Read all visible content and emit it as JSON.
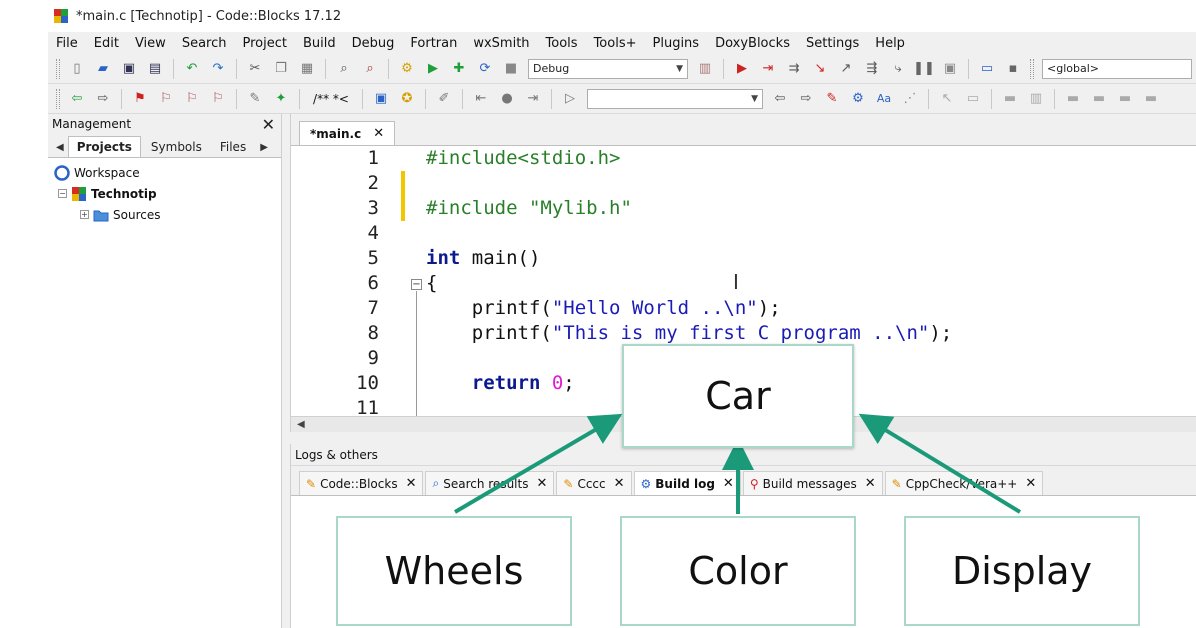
{
  "window": {
    "title": "*main.c [Technotip] - Code::Blocks 17.12"
  },
  "menu": [
    "File",
    "Edit",
    "View",
    "Search",
    "Project",
    "Build",
    "Debug",
    "Fortran",
    "wxSmith",
    "Tools",
    "Tools+",
    "Plugins",
    "DoxyBlocks",
    "Settings",
    "Help"
  ],
  "toolbar": {
    "build_target": "Debug",
    "scope": "<global>",
    "comment_glyph": "/** *<",
    "search_value": ""
  },
  "management": {
    "title": "Management",
    "tabs": [
      "Projects",
      "Symbols",
      "Files"
    ],
    "active_tab": "Projects",
    "tree": {
      "workspace": "Workspace",
      "project": "Technotip",
      "folder": "Sources"
    }
  },
  "editor": {
    "tab_label": "*main.c",
    "lines": [
      {
        "n": "1",
        "parts": [
          {
            "t": "#include<stdio.h>",
            "c": "pp"
          }
        ]
      },
      {
        "n": "2",
        "parts": []
      },
      {
        "n": "3",
        "parts": [
          {
            "t": "#include \"Mylib.h\"",
            "c": "pp"
          }
        ]
      },
      {
        "n": "4",
        "parts": []
      },
      {
        "n": "5",
        "parts": [
          {
            "t": "int",
            "c": "kw"
          },
          {
            "t": " main()",
            "c": ""
          }
        ]
      },
      {
        "n": "6",
        "parts": [
          {
            "t": "{",
            "c": ""
          }
        ]
      },
      {
        "n": "7",
        "parts": [
          {
            "t": "    printf(",
            "c": ""
          },
          {
            "t": "\"Hello World ..\\n\"",
            "c": "str"
          },
          {
            "t": ");",
            "c": ""
          }
        ]
      },
      {
        "n": "8",
        "parts": [
          {
            "t": "    printf(",
            "c": ""
          },
          {
            "t": "\"This is my first C program ..\\n\"",
            "c": "str"
          },
          {
            "t": ");",
            "c": ""
          }
        ]
      },
      {
        "n": "9",
        "parts": []
      },
      {
        "n": "10",
        "parts": [
          {
            "t": "    return",
            "c": "kw"
          },
          {
            "t": " ",
            "c": ""
          },
          {
            "t": "0",
            "c": "num"
          },
          {
            "t": ";",
            "c": ""
          }
        ]
      },
      {
        "n": "11",
        "parts": []
      }
    ]
  },
  "logs": {
    "title": "Logs & others",
    "tabs": [
      {
        "label": "Code::Blocks",
        "icon": "pencil-icon"
      },
      {
        "label": "Search results",
        "icon": "search-icon"
      },
      {
        "label": "Cccc",
        "icon": "pencil-icon"
      },
      {
        "label": "Build log",
        "icon": "gear-icon",
        "active": true
      },
      {
        "label": "Build messages",
        "icon": "pin-icon"
      },
      {
        "label": "CppCheck/Vera++",
        "icon": "pencil-icon"
      }
    ]
  },
  "diagram": {
    "parent": "Car",
    "children": [
      "Wheels",
      "Color",
      "Display"
    ],
    "arrow_color": "#1b9a7a",
    "box_border_color": "#a9d8c8"
  }
}
